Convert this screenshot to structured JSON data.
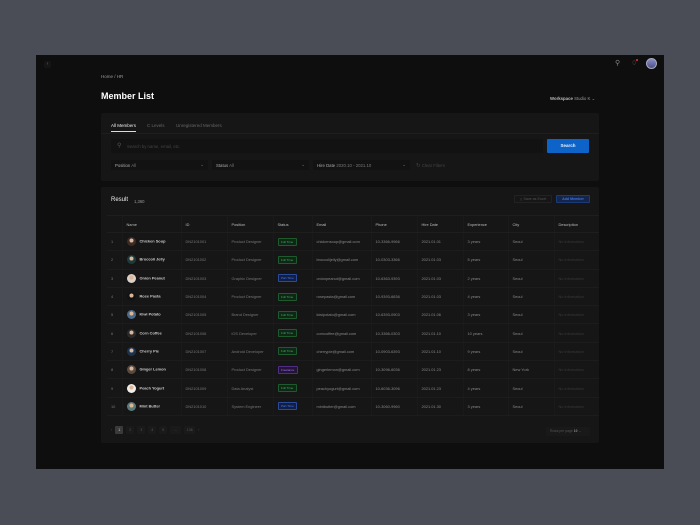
{
  "topbar": {
    "sidebar_toggle": "›",
    "search_icon": "search-icon",
    "bell_icon": "bell-icon"
  },
  "breadcrumb": [
    "Home",
    "/",
    "HR"
  ],
  "page_title": "Member List",
  "workspace": {
    "label": "Workspace",
    "value": "Studio K"
  },
  "tabs": [
    {
      "label": "All Members",
      "active": true
    },
    {
      "label": "C Levels"
    },
    {
      "label": "Unregistered Members"
    }
  ],
  "search": {
    "placeholder": "Search by name, email, etc.",
    "button": "Search"
  },
  "filters": {
    "position": {
      "label": "Position",
      "value": "All"
    },
    "status": {
      "label": "Status",
      "value": "All"
    },
    "hire_date": {
      "label": "Hire Date",
      "value": "2020.10 - 2021.10"
    },
    "clear": "Clear Filters"
  },
  "result": {
    "title": "Result",
    "count": "1,360",
    "save_excel": "Save as Excel",
    "add_member": "Add Member"
  },
  "columns": [
    "",
    "Name",
    "ID",
    "Position",
    "Status",
    "Email",
    "Phone",
    "Hire Date",
    "Experience",
    "City",
    "Description"
  ],
  "rows": [
    [
      "1",
      "Chicken Soup",
      "DN2101001",
      "Product Designer",
      "Full Time",
      "chickensoup@gmail.com",
      "10-3366-9966",
      "2021.01.01",
      "3 years",
      "Seoul",
      "No information"
    ],
    [
      "2",
      "Broccoli Jelly",
      "DN2101002",
      "Product Designer",
      "Full Time",
      "broccolijelly@gmail.com",
      "10-0303-3366",
      "2021.01.03",
      "5 years",
      "Seoul",
      "No information"
    ],
    [
      "3",
      "Onion Peanut",
      "DN2101003",
      "Graphic Designer",
      "Part Time",
      "onionpeanut@gmail.com",
      "10-6363-9393",
      "2021.01.03",
      "2 years",
      "Seoul",
      "No information"
    ],
    [
      "4",
      "Rose Pasta",
      "DN2101004",
      "Product Designer",
      "Full Time",
      "rosepasta@gmail.com",
      "10-9393-6636",
      "2021.01.03",
      "4 years",
      "Seoul",
      "No information"
    ],
    [
      "5",
      "Kiwi Potato",
      "DN2101005",
      "Brand Designer",
      "Full Time",
      "kiwipotato@gmail.com",
      "10-6393-0903",
      "2021.01.06",
      "3 years",
      "Seoul",
      "No information"
    ],
    [
      "6",
      "Corn Coffee",
      "DN2101006",
      "iOS Developer",
      "Full Time",
      "corncoffee@gmail.com",
      "10-3366-0303",
      "2021.01.10",
      "10 years",
      "Seoul",
      "No information"
    ],
    [
      "7",
      "Cherry Pie",
      "DN2101007",
      "Android Developer",
      "Full Time",
      "cherrypie@gmail.com",
      "10-0903-6393",
      "2021.01.10",
      "9 years",
      "Seoul",
      "No information"
    ],
    [
      "8",
      "Ginger Lemon",
      "DN2101008",
      "Product Designer",
      "Freelance",
      "gingerlemon@gmail.com",
      "10-3096-6036",
      "2021.01.23",
      "8 years",
      "New York",
      "No information"
    ],
    [
      "9",
      "Peach Yogurt",
      "DN2101009",
      "Data Analyst",
      "Full Time",
      "peachyogurt@gmail.com",
      "10-6036-3096",
      "2021.01.23",
      "4 years",
      "Seoul",
      "No information"
    ],
    [
      "10",
      "Mint Butter",
      "DN2101010",
      "System Engineer",
      "Part Time",
      "mintbutter@gmail.com",
      "10-3060-9960",
      "2021.01.30",
      "3 years",
      "Seoul",
      "No information"
    ]
  ],
  "pagination": {
    "prev": "‹",
    "pages": [
      "1",
      "2",
      "3",
      "4",
      "5",
      "...",
      "136"
    ],
    "next": "›",
    "active": "1",
    "rows_per_page_label": "Rows per page",
    "rows_per_page": "10"
  },
  "colors": {
    "accent": "#0d63c7",
    "full_time": "#3fae5a",
    "part_time": "#4a7ef0",
    "freelance": "#a46ef0"
  }
}
